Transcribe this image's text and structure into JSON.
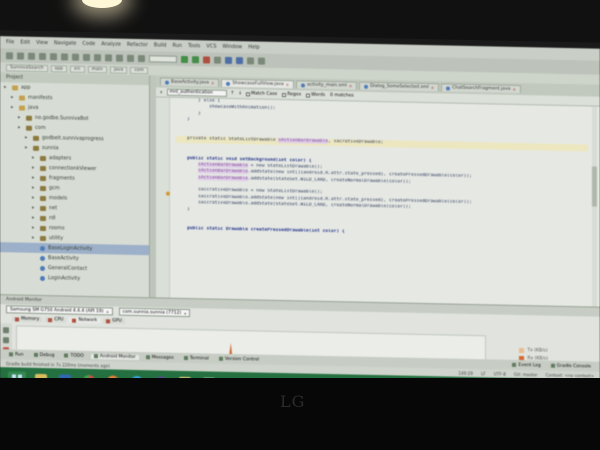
{
  "window": {
    "menu": [
      "File",
      "Edit",
      "View",
      "Navigate",
      "Code",
      "Analyze",
      "Refactor",
      "Build",
      "Run",
      "Tools",
      "VCS",
      "Window",
      "Help"
    ],
    "breadcrumbs": [
      "SunnivaSearch",
      "app",
      "src",
      "main",
      "java",
      "com"
    ]
  },
  "project_panel": {
    "header": "Project",
    "tree": [
      {
        "label": "app",
        "depth": 0,
        "type": "folder"
      },
      {
        "label": "manifests",
        "depth": 1,
        "type": "folder"
      },
      {
        "label": "java",
        "depth": 1,
        "type": "folder"
      },
      {
        "label": "no.godbe.SunnivaBot",
        "depth": 2,
        "type": "pkg"
      },
      {
        "label": "com",
        "depth": 2,
        "type": "pkg"
      },
      {
        "label": "godbeit.sunnivaprogress",
        "depth": 3,
        "type": "pkg"
      },
      {
        "label": "sunnia",
        "depth": 3,
        "type": "pkg"
      },
      {
        "label": "adapters",
        "depth": 4,
        "type": "pkg"
      },
      {
        "label": "connectionkViewer",
        "depth": 4,
        "type": "pkg"
      },
      {
        "label": "fragments",
        "depth": 4,
        "type": "pkg"
      },
      {
        "label": "gcm",
        "depth": 4,
        "type": "pkg"
      },
      {
        "label": "models",
        "depth": 4,
        "type": "pkg"
      },
      {
        "label": "net",
        "depth": 4,
        "type": "pkg"
      },
      {
        "label": "rdl",
        "depth": 4,
        "type": "pkg"
      },
      {
        "label": "rooms",
        "depth": 4,
        "type": "pkg"
      },
      {
        "label": "utility",
        "depth": 4,
        "type": "pkg"
      },
      {
        "label": "BaseLoginActivity",
        "depth": 4,
        "type": "file",
        "selected": true
      },
      {
        "label": "BaseActivity",
        "depth": 4,
        "type": "file"
      },
      {
        "label": "GeneralContact",
        "depth": 4,
        "type": "file"
      },
      {
        "label": "LoginActivity",
        "depth": 4,
        "type": "file"
      }
    ]
  },
  "editor": {
    "tabs": [
      {
        "label": "BaseActivity.java",
        "active": false
      },
      {
        "label": "ShowcaseFullView.java",
        "active": true
      },
      {
        "label": "activity_main.xml",
        "active": false
      },
      {
        "label": "Dialog_SomeSelected.xml",
        "active": false
      },
      {
        "label": "ChatSearchFragment.java",
        "active": false
      }
    ],
    "find": {
      "value": "mnl_authentication",
      "options": [
        "Match Case",
        "Regex",
        "Words",
        "0 matches"
      ]
    },
    "code_lines": [
      {
        "text": "        } else {",
        "type": "plain"
      },
      {
        "text": "            showcaseWithAnimation();",
        "type": "plain"
      },
      {
        "text": "        }",
        "type": "plain"
      },
      {
        "text": "    }",
        "type": "plain"
      },
      {
        "text": "",
        "type": "plain"
      },
      {
        "text": "",
        "type": "plain"
      },
      {
        "text": "    private static StateListDrawable ",
        "field": "sActionBarDrawable",
        "rest": ", sacrativeDrawable;",
        "type": "hl"
      },
      {
        "text": "",
        "type": "plain"
      },
      {
        "text": "",
        "type": "plain"
      },
      {
        "text": "    public static void setBackground(int color) {",
        "type": "kw"
      },
      {
        "text": "        ",
        "field": "sActionBarDrawable",
        "rest": " = new StateListDrawable();",
        "type": "field"
      },
      {
        "text": "        ",
        "field": "sActionBarDrawable",
        "rest": ".addState(new int[]{android.R.attr.state_pressed}, createPressedDrawable(color));",
        "type": "field"
      },
      {
        "text": "        ",
        "field": "sActionBarDrawable",
        "rest": ".addState(StateSet.WILD_CARD, createNormalDrawable(color));",
        "type": "field"
      },
      {
        "text": "",
        "type": "plain"
      },
      {
        "text": "        saccrativeDrawable = new StateListDrawable();",
        "type": "plain"
      },
      {
        "text": "        saccrativeDrawable.addState(new int[]{android.R.attr.state_pressed}, createPressedDrawable(color));",
        "type": "plain"
      },
      {
        "text": "        saccrativeDrawable.addState(StateSet.WILD_CARD, createNormalDrawable(color));",
        "type": "plain"
      },
      {
        "text": "    }",
        "type": "plain"
      },
      {
        "text": "",
        "type": "plain"
      },
      {
        "text": "",
        "type": "plain"
      },
      {
        "text": "    public static Drawable createPressedDrawable(int color) {",
        "type": "kw"
      },
      {
        "text": "        ",
        "type": "plain"
      }
    ]
  },
  "android_monitor": {
    "header": "Android Monitor",
    "device": "Samsung SM G750 Android 4.4.4 (API 19)",
    "process": "com.sunnia.sunnia (7712)",
    "tabs": [
      {
        "label": "Memory",
        "active": false
      },
      {
        "label": "CPU",
        "active": false
      },
      {
        "label": "Network",
        "active": true
      },
      {
        "label": "GPU",
        "active": false
      }
    ],
    "legend": [
      {
        "label": "Tx (KB/s)",
        "color": "#f2c093"
      },
      {
        "label": "Rx (KB/s)",
        "color": "#d9672b"
      }
    ],
    "spike_value": 1.0
  },
  "tool_windows": {
    "left": [
      "Run",
      "Debug",
      "TODO",
      "Android Monitor",
      "Messages",
      "Terminal",
      "Version Control"
    ],
    "right": [
      "Event Log",
      "Gradle Console"
    ]
  },
  "status": {
    "message": "Gradle build finished in 7s 220ms (moments ago)",
    "position": "149:29",
    "line_sep": "LF",
    "encoding": "UTF-8",
    "git": "Git: master",
    "context": "Context: <no context>"
  },
  "taskbar": {
    "apps": [
      "start",
      "file-explorer",
      "outlook",
      "chrome",
      "firefox",
      "skype",
      "media-player",
      "folder",
      "android-studio"
    ]
  },
  "monitor_brand": "LG"
}
